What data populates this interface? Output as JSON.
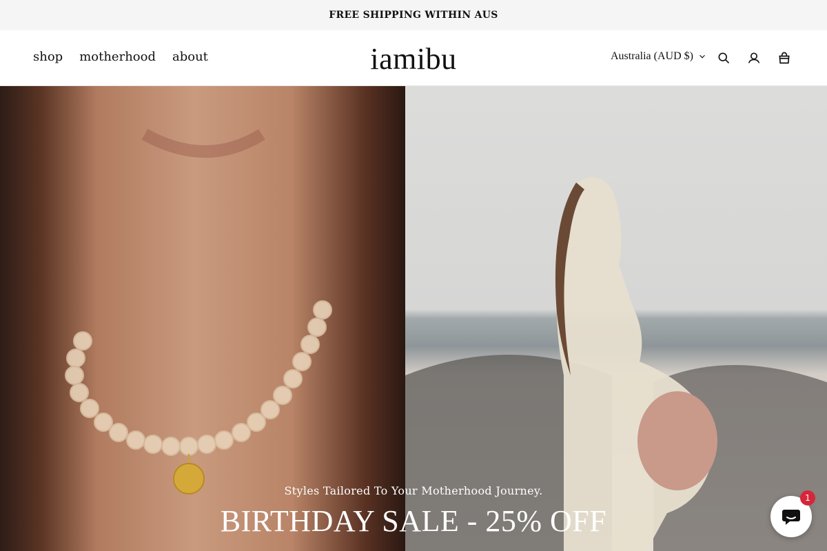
{
  "announcement": {
    "text": "FREE SHIPPING WITHIN AUS"
  },
  "nav": {
    "items": [
      {
        "label": "shop"
      },
      {
        "label": "motherhood"
      },
      {
        "label": "about"
      }
    ]
  },
  "brand": {
    "logo_text": "iamibu"
  },
  "header": {
    "currency_label": "Australia (AUD $)",
    "icons": [
      "chevron-down-icon",
      "search-icon",
      "account-icon",
      "cart-icon"
    ]
  },
  "hero": {
    "subtitle": "Styles Tailored To Your Motherhood Journey.",
    "title": "BIRTHDAY SALE - 25% OFF"
  },
  "chat": {
    "badge_count": "1",
    "icon": "chat-bubble-icon",
    "badge_color": "#d6263b"
  }
}
